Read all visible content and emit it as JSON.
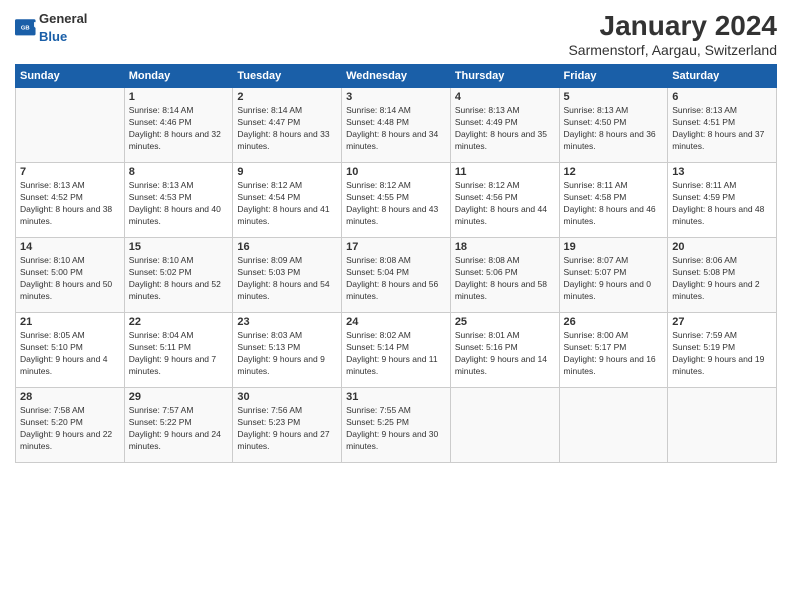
{
  "header": {
    "logo_general": "General",
    "logo_blue": "Blue",
    "month": "January 2024",
    "location": "Sarmenstorf, Aargau, Switzerland"
  },
  "weekdays": [
    "Sunday",
    "Monday",
    "Tuesday",
    "Wednesday",
    "Thursday",
    "Friday",
    "Saturday"
  ],
  "weeks": [
    [
      {
        "day": "",
        "sunrise": "",
        "sunset": "",
        "daylight": ""
      },
      {
        "day": "1",
        "sunrise": "Sunrise: 8:14 AM",
        "sunset": "Sunset: 4:46 PM",
        "daylight": "Daylight: 8 hours and 32 minutes."
      },
      {
        "day": "2",
        "sunrise": "Sunrise: 8:14 AM",
        "sunset": "Sunset: 4:47 PM",
        "daylight": "Daylight: 8 hours and 33 minutes."
      },
      {
        "day": "3",
        "sunrise": "Sunrise: 8:14 AM",
        "sunset": "Sunset: 4:48 PM",
        "daylight": "Daylight: 8 hours and 34 minutes."
      },
      {
        "day": "4",
        "sunrise": "Sunrise: 8:13 AM",
        "sunset": "Sunset: 4:49 PM",
        "daylight": "Daylight: 8 hours and 35 minutes."
      },
      {
        "day": "5",
        "sunrise": "Sunrise: 8:13 AM",
        "sunset": "Sunset: 4:50 PM",
        "daylight": "Daylight: 8 hours and 36 minutes."
      },
      {
        "day": "6",
        "sunrise": "Sunrise: 8:13 AM",
        "sunset": "Sunset: 4:51 PM",
        "daylight": "Daylight: 8 hours and 37 minutes."
      }
    ],
    [
      {
        "day": "7",
        "sunrise": "Sunrise: 8:13 AM",
        "sunset": "Sunset: 4:52 PM",
        "daylight": "Daylight: 8 hours and 38 minutes."
      },
      {
        "day": "8",
        "sunrise": "Sunrise: 8:13 AM",
        "sunset": "Sunset: 4:53 PM",
        "daylight": "Daylight: 8 hours and 40 minutes."
      },
      {
        "day": "9",
        "sunrise": "Sunrise: 8:12 AM",
        "sunset": "Sunset: 4:54 PM",
        "daylight": "Daylight: 8 hours and 41 minutes."
      },
      {
        "day": "10",
        "sunrise": "Sunrise: 8:12 AM",
        "sunset": "Sunset: 4:55 PM",
        "daylight": "Daylight: 8 hours and 43 minutes."
      },
      {
        "day": "11",
        "sunrise": "Sunrise: 8:12 AM",
        "sunset": "Sunset: 4:56 PM",
        "daylight": "Daylight: 8 hours and 44 minutes."
      },
      {
        "day": "12",
        "sunrise": "Sunrise: 8:11 AM",
        "sunset": "Sunset: 4:58 PM",
        "daylight": "Daylight: 8 hours and 46 minutes."
      },
      {
        "day": "13",
        "sunrise": "Sunrise: 8:11 AM",
        "sunset": "Sunset: 4:59 PM",
        "daylight": "Daylight: 8 hours and 48 minutes."
      }
    ],
    [
      {
        "day": "14",
        "sunrise": "Sunrise: 8:10 AM",
        "sunset": "Sunset: 5:00 PM",
        "daylight": "Daylight: 8 hours and 50 minutes."
      },
      {
        "day": "15",
        "sunrise": "Sunrise: 8:10 AM",
        "sunset": "Sunset: 5:02 PM",
        "daylight": "Daylight: 8 hours and 52 minutes."
      },
      {
        "day": "16",
        "sunrise": "Sunrise: 8:09 AM",
        "sunset": "Sunset: 5:03 PM",
        "daylight": "Daylight: 8 hours and 54 minutes."
      },
      {
        "day": "17",
        "sunrise": "Sunrise: 8:08 AM",
        "sunset": "Sunset: 5:04 PM",
        "daylight": "Daylight: 8 hours and 56 minutes."
      },
      {
        "day": "18",
        "sunrise": "Sunrise: 8:08 AM",
        "sunset": "Sunset: 5:06 PM",
        "daylight": "Daylight: 8 hours and 58 minutes."
      },
      {
        "day": "19",
        "sunrise": "Sunrise: 8:07 AM",
        "sunset": "Sunset: 5:07 PM",
        "daylight": "Daylight: 9 hours and 0 minutes."
      },
      {
        "day": "20",
        "sunrise": "Sunrise: 8:06 AM",
        "sunset": "Sunset: 5:08 PM",
        "daylight": "Daylight: 9 hours and 2 minutes."
      }
    ],
    [
      {
        "day": "21",
        "sunrise": "Sunrise: 8:05 AM",
        "sunset": "Sunset: 5:10 PM",
        "daylight": "Daylight: 9 hours and 4 minutes."
      },
      {
        "day": "22",
        "sunrise": "Sunrise: 8:04 AM",
        "sunset": "Sunset: 5:11 PM",
        "daylight": "Daylight: 9 hours and 7 minutes."
      },
      {
        "day": "23",
        "sunrise": "Sunrise: 8:03 AM",
        "sunset": "Sunset: 5:13 PM",
        "daylight": "Daylight: 9 hours and 9 minutes."
      },
      {
        "day": "24",
        "sunrise": "Sunrise: 8:02 AM",
        "sunset": "Sunset: 5:14 PM",
        "daylight": "Daylight: 9 hours and 11 minutes."
      },
      {
        "day": "25",
        "sunrise": "Sunrise: 8:01 AM",
        "sunset": "Sunset: 5:16 PM",
        "daylight": "Daylight: 9 hours and 14 minutes."
      },
      {
        "day": "26",
        "sunrise": "Sunrise: 8:00 AM",
        "sunset": "Sunset: 5:17 PM",
        "daylight": "Daylight: 9 hours and 16 minutes."
      },
      {
        "day": "27",
        "sunrise": "Sunrise: 7:59 AM",
        "sunset": "Sunset: 5:19 PM",
        "daylight": "Daylight: 9 hours and 19 minutes."
      }
    ],
    [
      {
        "day": "28",
        "sunrise": "Sunrise: 7:58 AM",
        "sunset": "Sunset: 5:20 PM",
        "daylight": "Daylight: 9 hours and 22 minutes."
      },
      {
        "day": "29",
        "sunrise": "Sunrise: 7:57 AM",
        "sunset": "Sunset: 5:22 PM",
        "daylight": "Daylight: 9 hours and 24 minutes."
      },
      {
        "day": "30",
        "sunrise": "Sunrise: 7:56 AM",
        "sunset": "Sunset: 5:23 PM",
        "daylight": "Daylight: 9 hours and 27 minutes."
      },
      {
        "day": "31",
        "sunrise": "Sunrise: 7:55 AM",
        "sunset": "Sunset: 5:25 PM",
        "daylight": "Daylight: 9 hours and 30 minutes."
      },
      {
        "day": "",
        "sunrise": "",
        "sunset": "",
        "daylight": ""
      },
      {
        "day": "",
        "sunrise": "",
        "sunset": "",
        "daylight": ""
      },
      {
        "day": "",
        "sunrise": "",
        "sunset": "",
        "daylight": ""
      }
    ]
  ]
}
